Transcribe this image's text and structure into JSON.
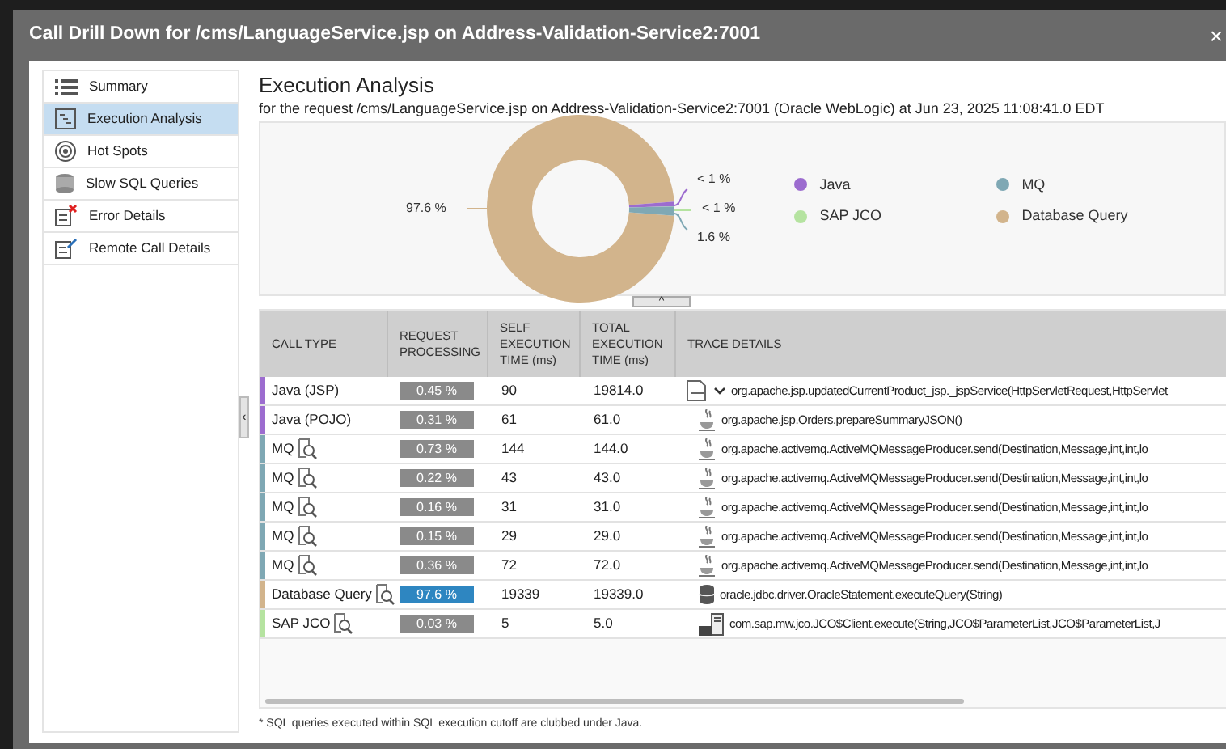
{
  "window": {
    "title": "Call Drill Down for /cms/LanguageService.jsp on Address-Validation-Service2:7001",
    "close": "×"
  },
  "sidebar": {
    "items": [
      {
        "label": "Summary",
        "selected": false
      },
      {
        "label": "Execution Analysis",
        "selected": true
      },
      {
        "label": "Hot Spots",
        "selected": false
      },
      {
        "label": "Slow SQL Queries",
        "selected": false
      },
      {
        "label": "Error Details",
        "selected": false
      },
      {
        "label": "Remote Call Details",
        "selected": false
      }
    ],
    "collapse": "‹"
  },
  "main": {
    "title": "Execution Analysis",
    "subtitle": "for the request /cms/LanguageService.jsp on Address-Validation-Service2:7001 (Oracle WebLogic) at Jun 23, 2025 11:08:41.0 EDT",
    "slice_labels": [
      "97.6 %",
      "< 1 %",
      "< 1 %",
      "1.6 %"
    ],
    "legend": [
      {
        "label": "Java",
        "color": "#9c6ccf"
      },
      {
        "label": "MQ",
        "color": "#7fa8b4"
      },
      {
        "label": "SAP JCO",
        "color": "#b5e3a0"
      },
      {
        "label": "Database Query",
        "color": "#d2b48c"
      }
    ],
    "chart_toggle": "^"
  },
  "table": {
    "columns": [
      "CALL TYPE",
      "REQUEST PROCESSING",
      "SELF EXECUTION TIME (ms)",
      "TOTAL EXECUTION TIME (ms)",
      "TRACE DETAILS"
    ],
    "rows": [
      {
        "call_type": "Java (JSP)",
        "color": "#9c6ccf",
        "searchable": false,
        "processing": "0.45 %",
        "highlighted": false,
        "self": "90",
        "total": "19814.0",
        "kind": "jsp",
        "trace": "org.apache.jsp.updatedCurrentProduct_jsp._jspService(HttpServletRequest,HttpServlet",
        "expanded": true,
        "children": [
          {
            "call_type": "Java (POJO)",
            "color": "#9c6ccf",
            "searchable": false,
            "processing": "0.31 %",
            "highlighted": false,
            "self": "61",
            "total": "61.0",
            "kind": "java",
            "trace": "org.apache.jsp.Orders.prepareSummaryJSON()"
          },
          {
            "call_type": "MQ",
            "color": "#7fa8b4",
            "searchable": true,
            "processing": "0.73 %",
            "highlighted": false,
            "self": "144",
            "total": "144.0",
            "kind": "java",
            "trace": "org.apache.activemq.ActiveMQMessageProducer.send(Destination,Message,int,int,lo"
          },
          {
            "call_type": "MQ",
            "color": "#7fa8b4",
            "searchable": true,
            "processing": "0.22 %",
            "highlighted": false,
            "self": "43",
            "total": "43.0",
            "kind": "java",
            "trace": "org.apache.activemq.ActiveMQMessageProducer.send(Destination,Message,int,int,lo"
          },
          {
            "call_type": "MQ",
            "color": "#7fa8b4",
            "searchable": true,
            "processing": "0.16 %",
            "highlighted": false,
            "self": "31",
            "total": "31.0",
            "kind": "java",
            "trace": "org.apache.activemq.ActiveMQMessageProducer.send(Destination,Message,int,int,lo"
          },
          {
            "call_type": "MQ",
            "color": "#7fa8b4",
            "searchable": true,
            "processing": "0.15 %",
            "highlighted": false,
            "self": "29",
            "total": "29.0",
            "kind": "java",
            "trace": "org.apache.activemq.ActiveMQMessageProducer.send(Destination,Message,int,int,lo"
          },
          {
            "call_type": "MQ",
            "color": "#7fa8b4",
            "searchable": true,
            "processing": "0.36 %",
            "highlighted": false,
            "self": "72",
            "total": "72.0",
            "kind": "java",
            "trace": "org.apache.activemq.ActiveMQMessageProducer.send(Destination,Message,int,int,lo"
          },
          {
            "call_type": "Database Query",
            "color": "#d2b48c",
            "searchable": true,
            "processing": "97.6 %",
            "highlighted": true,
            "self": "19339",
            "total": "19339.0",
            "kind": "db",
            "trace": "oracle.jdbc.driver.OracleStatement.executeQuery(String)"
          },
          {
            "call_type": "SAP JCO",
            "color": "#b5e3a0",
            "searchable": true,
            "processing": "0.03 %",
            "highlighted": false,
            "self": "5",
            "total": "5.0",
            "kind": "sap",
            "trace": "com.sap.mw.jco.JCO$Client.execute(String,JCO$ParameterList,JCO$ParameterList,J"
          }
        ]
      }
    ]
  },
  "footnote": "* SQL queries executed within SQL execution cutoff are clubbed under Java."
}
